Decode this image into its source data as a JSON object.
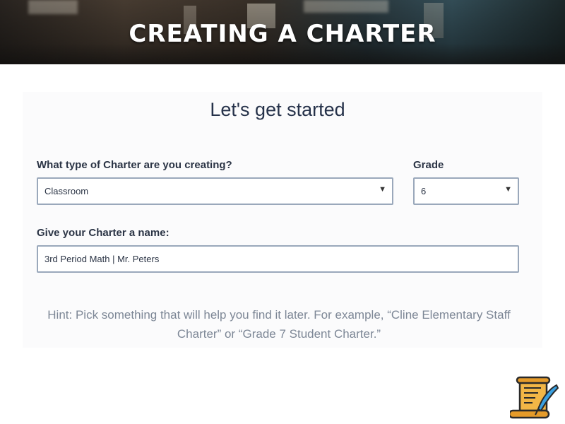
{
  "banner": {
    "title": "CREATING A CHARTER"
  },
  "form": {
    "heading": "Let's get started",
    "charter_type": {
      "label": "What type of Charter are you creating?",
      "value": "Classroom"
    },
    "grade": {
      "label": "Grade",
      "value": "6"
    },
    "name": {
      "label": "Give your Charter a name:",
      "value": "3rd Period Math | Mr. Peters"
    },
    "hint": "Hint: Pick something that will help you find it later. For example, “Cline Elementary Staff Charter” or “Grade 7 Student Charter.”"
  },
  "icons": {
    "dropdown": "chevron-down-icon",
    "decoration": "scroll-quill-icon"
  },
  "colors": {
    "heading": "#26324a",
    "field_border": "#9aa8bb",
    "hint": "#7d8796"
  }
}
